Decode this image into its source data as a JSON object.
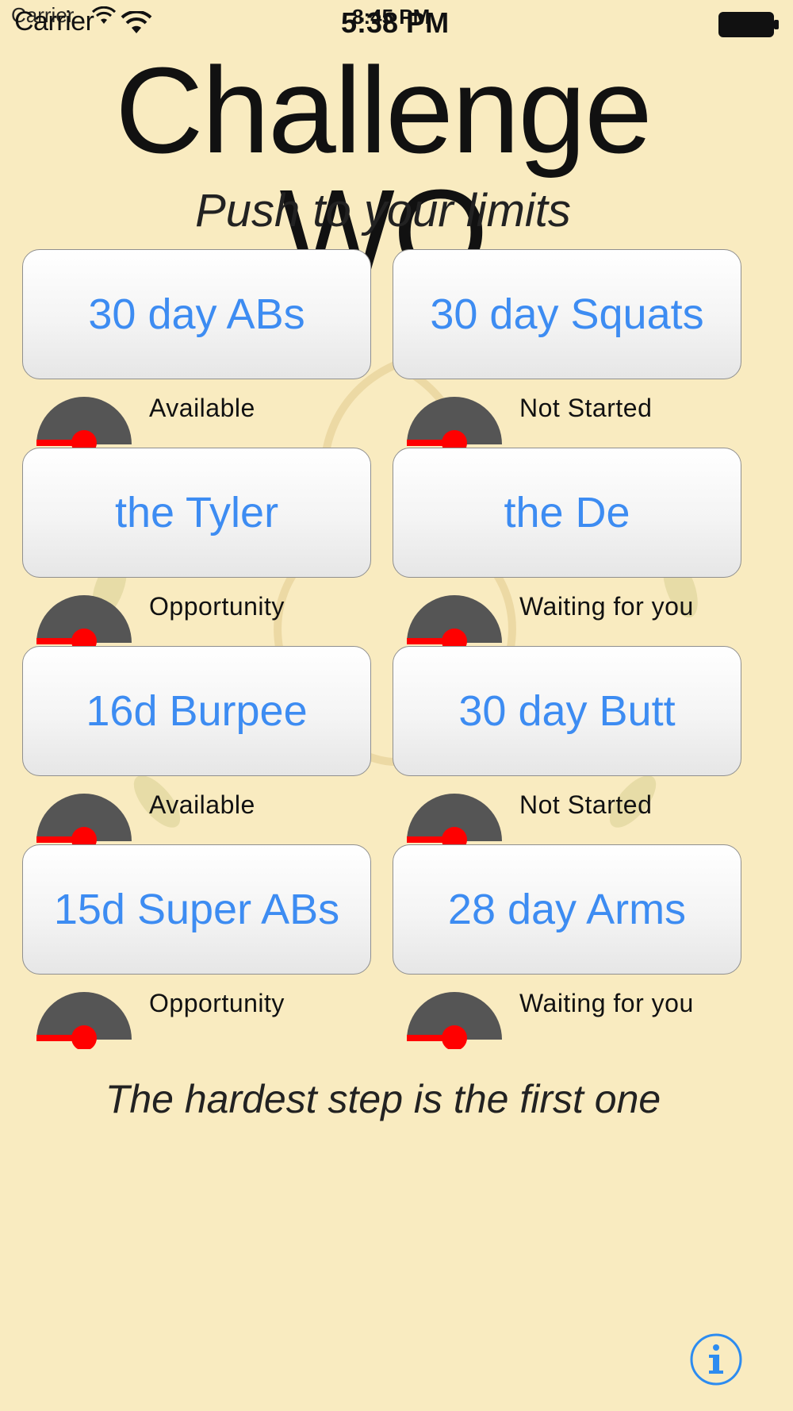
{
  "status_bar": {
    "carrier": "Carrier",
    "carrier_ghost": "Carrier",
    "time": "5:38 PM",
    "time_ghost": "8:45 PM"
  },
  "header": {
    "title": "Challenge WO",
    "subtitle": "Push to your limits"
  },
  "challenges": [
    {
      "label": "30 day ABs",
      "status": "Available"
    },
    {
      "label": "30 day Squats",
      "status": "Not Started"
    },
    {
      "label": "the Tyler",
      "status": "Opportunity"
    },
    {
      "label": "the De",
      "status": "Waiting for you"
    },
    {
      "label": "16d Burpee",
      "status": "Available"
    },
    {
      "label": "30 day Butt",
      "status": "Not Started"
    },
    {
      "label": "15d Super ABs",
      "status": "Opportunity"
    },
    {
      "label": "28 day Arms",
      "status": "Waiting for you"
    }
  ],
  "footer": {
    "quote": "The hardest step is the first one"
  },
  "colors": {
    "background": "#f9ebc0",
    "button_text": "#3d8cf2",
    "gauge_dark": "#555555",
    "gauge_needle": "#ff0000",
    "info_blue": "#2d8cf0"
  },
  "icons": {
    "info": "info-icon",
    "wifi": "wifi-icon",
    "battery": "battery-icon"
  }
}
